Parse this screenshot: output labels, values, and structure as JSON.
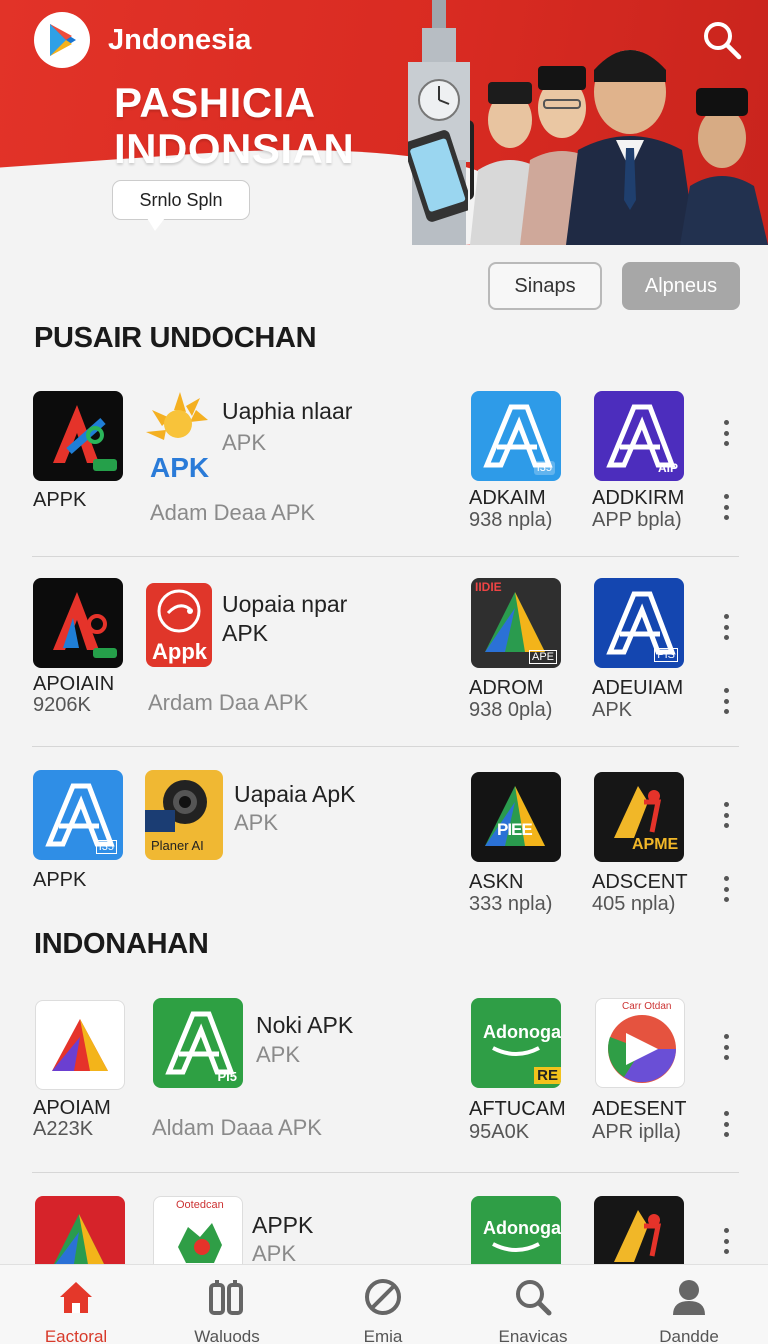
{
  "header": {
    "brand": "Jndonesia",
    "headline_line1": "PASHICIA",
    "headline_line2": "INDONSIAN",
    "bubble": "Srnlo Spln"
  },
  "chips": {
    "outline": "Sinaps",
    "filled": "Alpneus"
  },
  "sections": [
    {
      "title": "PUSAIR UNDOCHAN"
    },
    {
      "title": "INDONAHAN"
    }
  ],
  "rows": [
    {
      "left_icon_label": "APPK",
      "left_icon_sub": "",
      "mid_icon_text": "APK",
      "name": "Uaphia nlaar",
      "type": "APK",
      "developer": "Adam Deaa APK",
      "right1_label": "ADKAIM",
      "right1_sub": "938 npla)",
      "right2_label": "ADDKIRM",
      "right2_sub": "APP bpla)",
      "right1_badge": "I35",
      "right2_badge": "AIP"
    },
    {
      "left_icon_label": "APOIAIN",
      "left_icon_sub": "9206K",
      "mid_icon_text": "Appk",
      "name": "Uopaia npar",
      "type": "APK",
      "developer": "Ardam Daa APK",
      "right1_label": "ADROM",
      "right1_sub": "938 0pla)",
      "right2_label": "ADEUIAM",
      "right2_sub": "APK",
      "right1_badge": "APE",
      "right1_top": "IIDIE",
      "right2_badge": "PIS"
    },
    {
      "left_icon_label": "APPK",
      "left_icon_sub": "",
      "mid_icon_text": "Planer AI",
      "name": "Uapaia ApK",
      "type": "APK",
      "developer": "",
      "right1_label": "ASKN",
      "right1_sub": "333 npla)",
      "right2_label": "ADSCENT",
      "right2_sub": "405 npla)",
      "right1_overlay": "PIEE",
      "right2_overlay": "APME",
      "left_badge": "I35"
    },
    {
      "left_icon_label": "APOIAM",
      "left_icon_sub": "A223K",
      "mid_icon_text": "PI5",
      "name": "Noki APK",
      "type": "APK",
      "developer": "Aldam Daaa APK",
      "right1_label": "AFTUCAM",
      "right1_sub": "95A0K",
      "right2_label": "ADESENT",
      "right2_sub": "APR iplla)",
      "right1_overlay": "Adonogan",
      "right1_corner": "RE",
      "right2_top": "Carr Otdan"
    },
    {
      "mid_top": "Ootedcan",
      "name": "APPK",
      "type": "APK",
      "right1_overlay": "Adonogan"
    }
  ],
  "bottom_nav": [
    {
      "label": "Eactoral",
      "icon": "home-icon",
      "active": true
    },
    {
      "label": "Waluods",
      "icon": "library-icon",
      "active": false
    },
    {
      "label": "Emia",
      "icon": "block-icon",
      "active": false
    },
    {
      "label": "Enavicas",
      "icon": "search-icon",
      "active": false
    },
    {
      "label": "Dandde",
      "icon": "profile-icon",
      "active": false
    }
  ],
  "colors": {
    "brand_red": "#d92b22",
    "active_nav": "#d83a2a"
  }
}
